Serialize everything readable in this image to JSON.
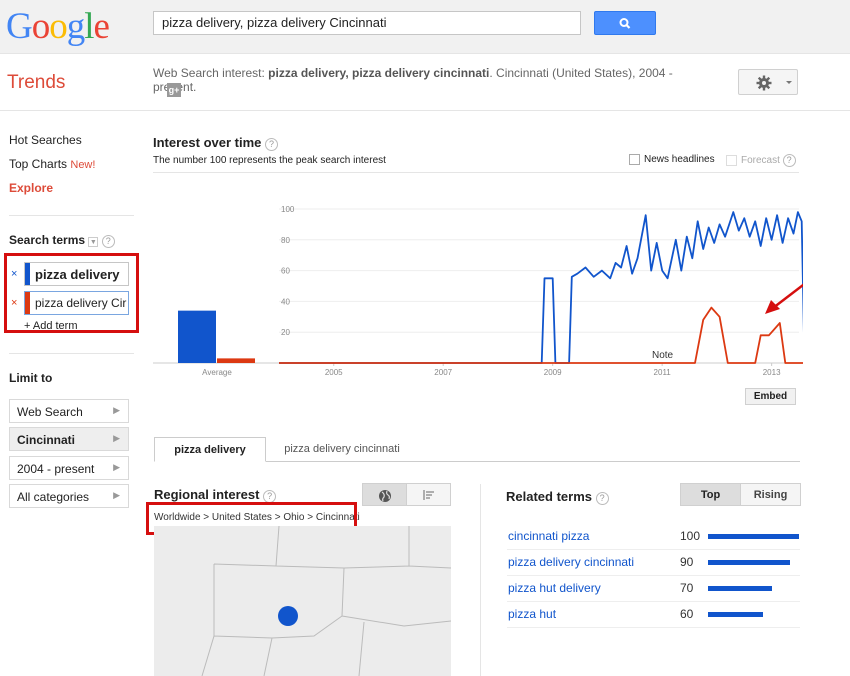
{
  "header": {
    "logo": "Google",
    "search_value": "pizza delivery, pizza delivery Cincinnati",
    "search_button_icon": "search-icon"
  },
  "subheader": {
    "app_title": "Trends",
    "subtitle_prefix": "Web Search interest: ",
    "subtitle_terms": "pizza delivery, pizza delivery cincinnati",
    "subtitle_suffix": ". Cincinnati (United States), 2004 - present.",
    "settings_icon": "gear-icon"
  },
  "sidebar": {
    "hot_searches": "Hot Searches",
    "top_charts": "Top Charts",
    "top_charts_badge": "New!",
    "explore": "Explore",
    "search_terms_label": "Search terms",
    "terms": [
      {
        "label": "pizza delivery",
        "color": "#1155cc"
      },
      {
        "label": "pizza delivery Cir",
        "color": "#dc3912"
      }
    ],
    "add_term": "+ Add term",
    "limit_to": "Limit to",
    "filters": [
      "Web Search",
      "Cincinnati",
      "2004 - present",
      "All categories"
    ]
  },
  "interest": {
    "title": "Interest over time",
    "caption": "The number 100 represents the peak search interest",
    "news_headlines": "News headlines",
    "forecast": "Forecast",
    "embed": "Embed",
    "note": "Note",
    "average_label": "Average"
  },
  "chart_data": {
    "type": "line",
    "x_ticks": [
      "2005",
      "2007",
      "2009",
      "2011",
      "2013"
    ],
    "y_ticks": [
      100,
      80,
      60,
      40,
      20
    ],
    "ylim": [
      0,
      100
    ],
    "xlim": [
      2004,
      2013.5
    ],
    "average_bars": [
      {
        "series": "pizza delivery",
        "value": 34
      },
      {
        "series": "pizza delivery cincinnati",
        "value": 3
      }
    ],
    "series": [
      {
        "name": "pizza delivery",
        "color": "#1155cc",
        "points": [
          [
            2004,
            0
          ],
          [
            2008.8,
            0
          ],
          [
            2008.85,
            55
          ],
          [
            2008.95,
            55
          ],
          [
            2009.0,
            55
          ],
          [
            2009.05,
            0
          ],
          [
            2009.3,
            0
          ],
          [
            2009.35,
            56
          ],
          [
            2009.45,
            58
          ],
          [
            2009.6,
            62
          ],
          [
            2009.75,
            56
          ],
          [
            2009.9,
            60
          ],
          [
            2010.05,
            55
          ],
          [
            2010.15,
            65
          ],
          [
            2010.25,
            62
          ],
          [
            2010.35,
            76
          ],
          [
            2010.45,
            58
          ],
          [
            2010.55,
            68
          ],
          [
            2010.7,
            96
          ],
          [
            2010.8,
            60
          ],
          [
            2010.9,
            78
          ],
          [
            2011.0,
            60
          ],
          [
            2011.1,
            55
          ],
          [
            2011.25,
            80
          ],
          [
            2011.35,
            60
          ],
          [
            2011.45,
            82
          ],
          [
            2011.55,
            68
          ],
          [
            2011.65,
            92
          ],
          [
            2011.75,
            74
          ],
          [
            2011.85,
            88
          ],
          [
            2011.95,
            78
          ],
          [
            2012.05,
            90
          ],
          [
            2012.15,
            82
          ],
          [
            2012.3,
            98
          ],
          [
            2012.4,
            86
          ],
          [
            2012.5,
            94
          ],
          [
            2012.6,
            82
          ],
          [
            2012.7,
            92
          ],
          [
            2012.8,
            76
          ],
          [
            2012.9,
            94
          ],
          [
            2013.0,
            80
          ],
          [
            2013.1,
            96
          ],
          [
            2013.2,
            78
          ],
          [
            2013.3,
            94
          ],
          [
            2013.4,
            84
          ],
          [
            2013.48,
            98
          ],
          [
            2013.55,
            92
          ],
          [
            2013.6,
            0
          ]
        ]
      },
      {
        "name": "pizza delivery cincinnati",
        "color": "#dc3912",
        "points": [
          [
            2004,
            0
          ],
          [
            2011.6,
            0
          ],
          [
            2011.75,
            28
          ],
          [
            2011.9,
            36
          ],
          [
            2012.05,
            30
          ],
          [
            2012.2,
            0
          ],
          [
            2012.7,
            0
          ],
          [
            2012.8,
            18
          ],
          [
            2012.95,
            18
          ],
          [
            2013.05,
            22
          ],
          [
            2013.15,
            26
          ],
          [
            2013.25,
            0
          ],
          [
            2013.6,
            0
          ]
        ]
      }
    ]
  },
  "tabs": [
    "pizza delivery",
    "pizza delivery cincinnati"
  ],
  "regional": {
    "title": "Regional interest",
    "breadcrumb": "Worldwide > United States > Ohio > Cincinnati",
    "map_icon": "globe-icon",
    "list_icon": "list-icon"
  },
  "related": {
    "title": "Related terms",
    "top_label": "Top",
    "rising_label": "Rising",
    "items": [
      {
        "term": "cincinnati pizza",
        "value": 100
      },
      {
        "term": "pizza delivery cincinnati",
        "value": 90
      },
      {
        "term": "pizza hut delivery",
        "value": 70
      },
      {
        "term": "pizza hut",
        "value": 60
      }
    ]
  }
}
